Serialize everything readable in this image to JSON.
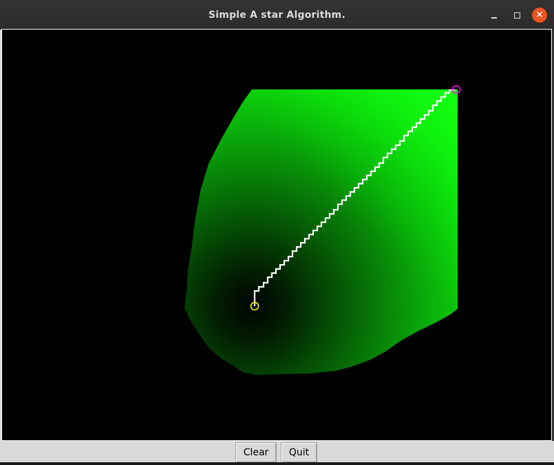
{
  "window": {
    "title": "Simple A star Algorithm."
  },
  "titlebar_buttons": {
    "minimize": "minimize",
    "maximize": "maximize",
    "close": "✕"
  },
  "canvas": {
    "background": "#000000",
    "explored_color_dark": "#000000",
    "explored_color_bright": "#00ff00",
    "path_color": "#ffffff",
    "start_marker_color": "#ffff00",
    "goal_marker_color": "#ff00ff"
  },
  "controls": {
    "clear_label": "Clear",
    "quit_label": "Quit"
  }
}
